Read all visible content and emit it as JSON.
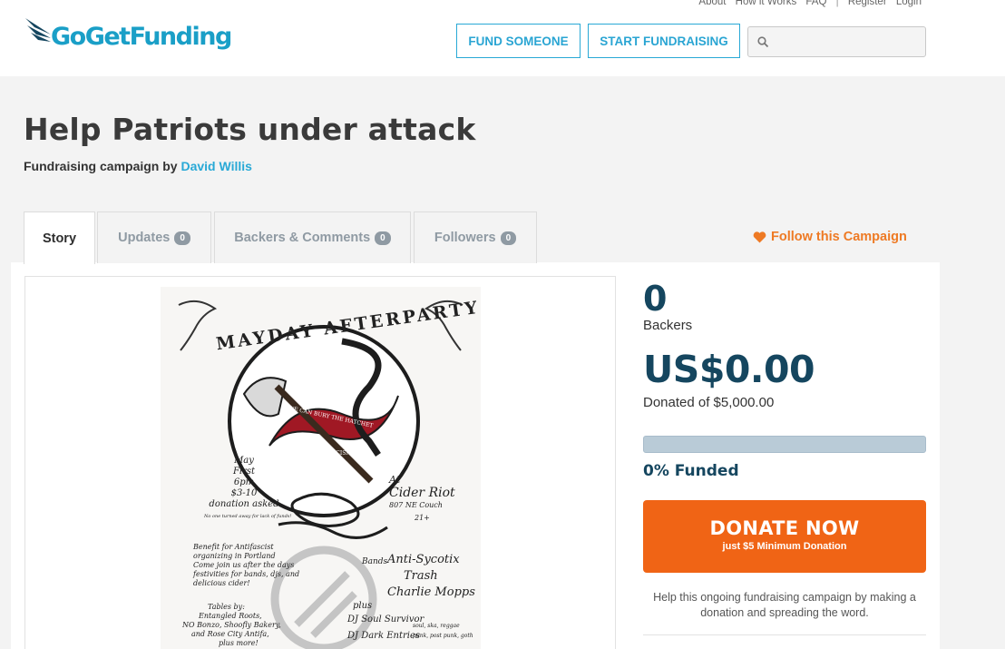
{
  "header": {
    "logo_text": "GoGetFunding",
    "top_links": [
      "About",
      "How it Works",
      "FAQ",
      "Register",
      "Login"
    ],
    "fund_someone_label": "FUND SOMEONE",
    "start_fundraising_label": "START FUNDRAISING",
    "search_placeholder": ""
  },
  "campaign": {
    "title": "Help Patriots under attack",
    "byline_prefix": "Fundraising campaign by",
    "author": "David Willis"
  },
  "tabs": [
    {
      "label": "Story",
      "count": null,
      "active": true
    },
    {
      "label": "Updates",
      "count": "0"
    },
    {
      "label": "Backers & Comments",
      "count": "0"
    },
    {
      "label": "Followers",
      "count": "0"
    }
  ],
  "follow_label": "Follow this Campaign",
  "poster": {
    "title": "MAYDAY AFTERPARTY",
    "ribbon_top": "WE CAN BURY THE HATCHET",
    "ribbon_bottom": "ONCE WE BURY FASCISM",
    "date_lines": [
      "May",
      "First",
      "6pm",
      "$3-10",
      "donation asked"
    ],
    "no_one_turned": "No one turned away for lack of funds!",
    "venue_lines": [
      "At",
      "Cider Riot",
      "807 NE Couch",
      "21+"
    ],
    "benefit_lines": [
      "Benefit for Antifascist",
      "organizing in Portland",
      "Come join us after the days",
      "festivities for bands, djs, and",
      "delicious cider!"
    ],
    "bands_label": "Bands",
    "bands": [
      "Anti-Sycotix",
      "Trash",
      "Charlie Mopps"
    ],
    "plus_label": "plus",
    "djs": [
      "DJ Soul Survivor",
      "DJ Dark Entries"
    ],
    "tables_lines": [
      "Tables by:",
      "Entangled Roots,",
      "NO Bonzo, Shoofly Bakery,",
      "and Rose City Antifa,",
      "plus more!"
    ],
    "genre_lines": [
      "soul, ska, reggae",
      "punk, post punk, goth"
    ]
  },
  "stats": {
    "backers_count": "0",
    "backers_label": "Backers",
    "amount": "US$0.00",
    "donated_of": "Donated of $5,000.00",
    "progress_fraction": 0,
    "funded_label": "0% Funded"
  },
  "donate": {
    "main_label": "DONATE NOW",
    "sub_label": "just $5 Minimum Donation"
  },
  "help_text": "Help this ongoing fundraising campaign by making a donation and spreading the word.",
  "colors": {
    "brand_blue": "#29a9d6",
    "navy": "#15465f",
    "donate_orange": "#f06415",
    "follow_orange": "#ee7a24"
  }
}
